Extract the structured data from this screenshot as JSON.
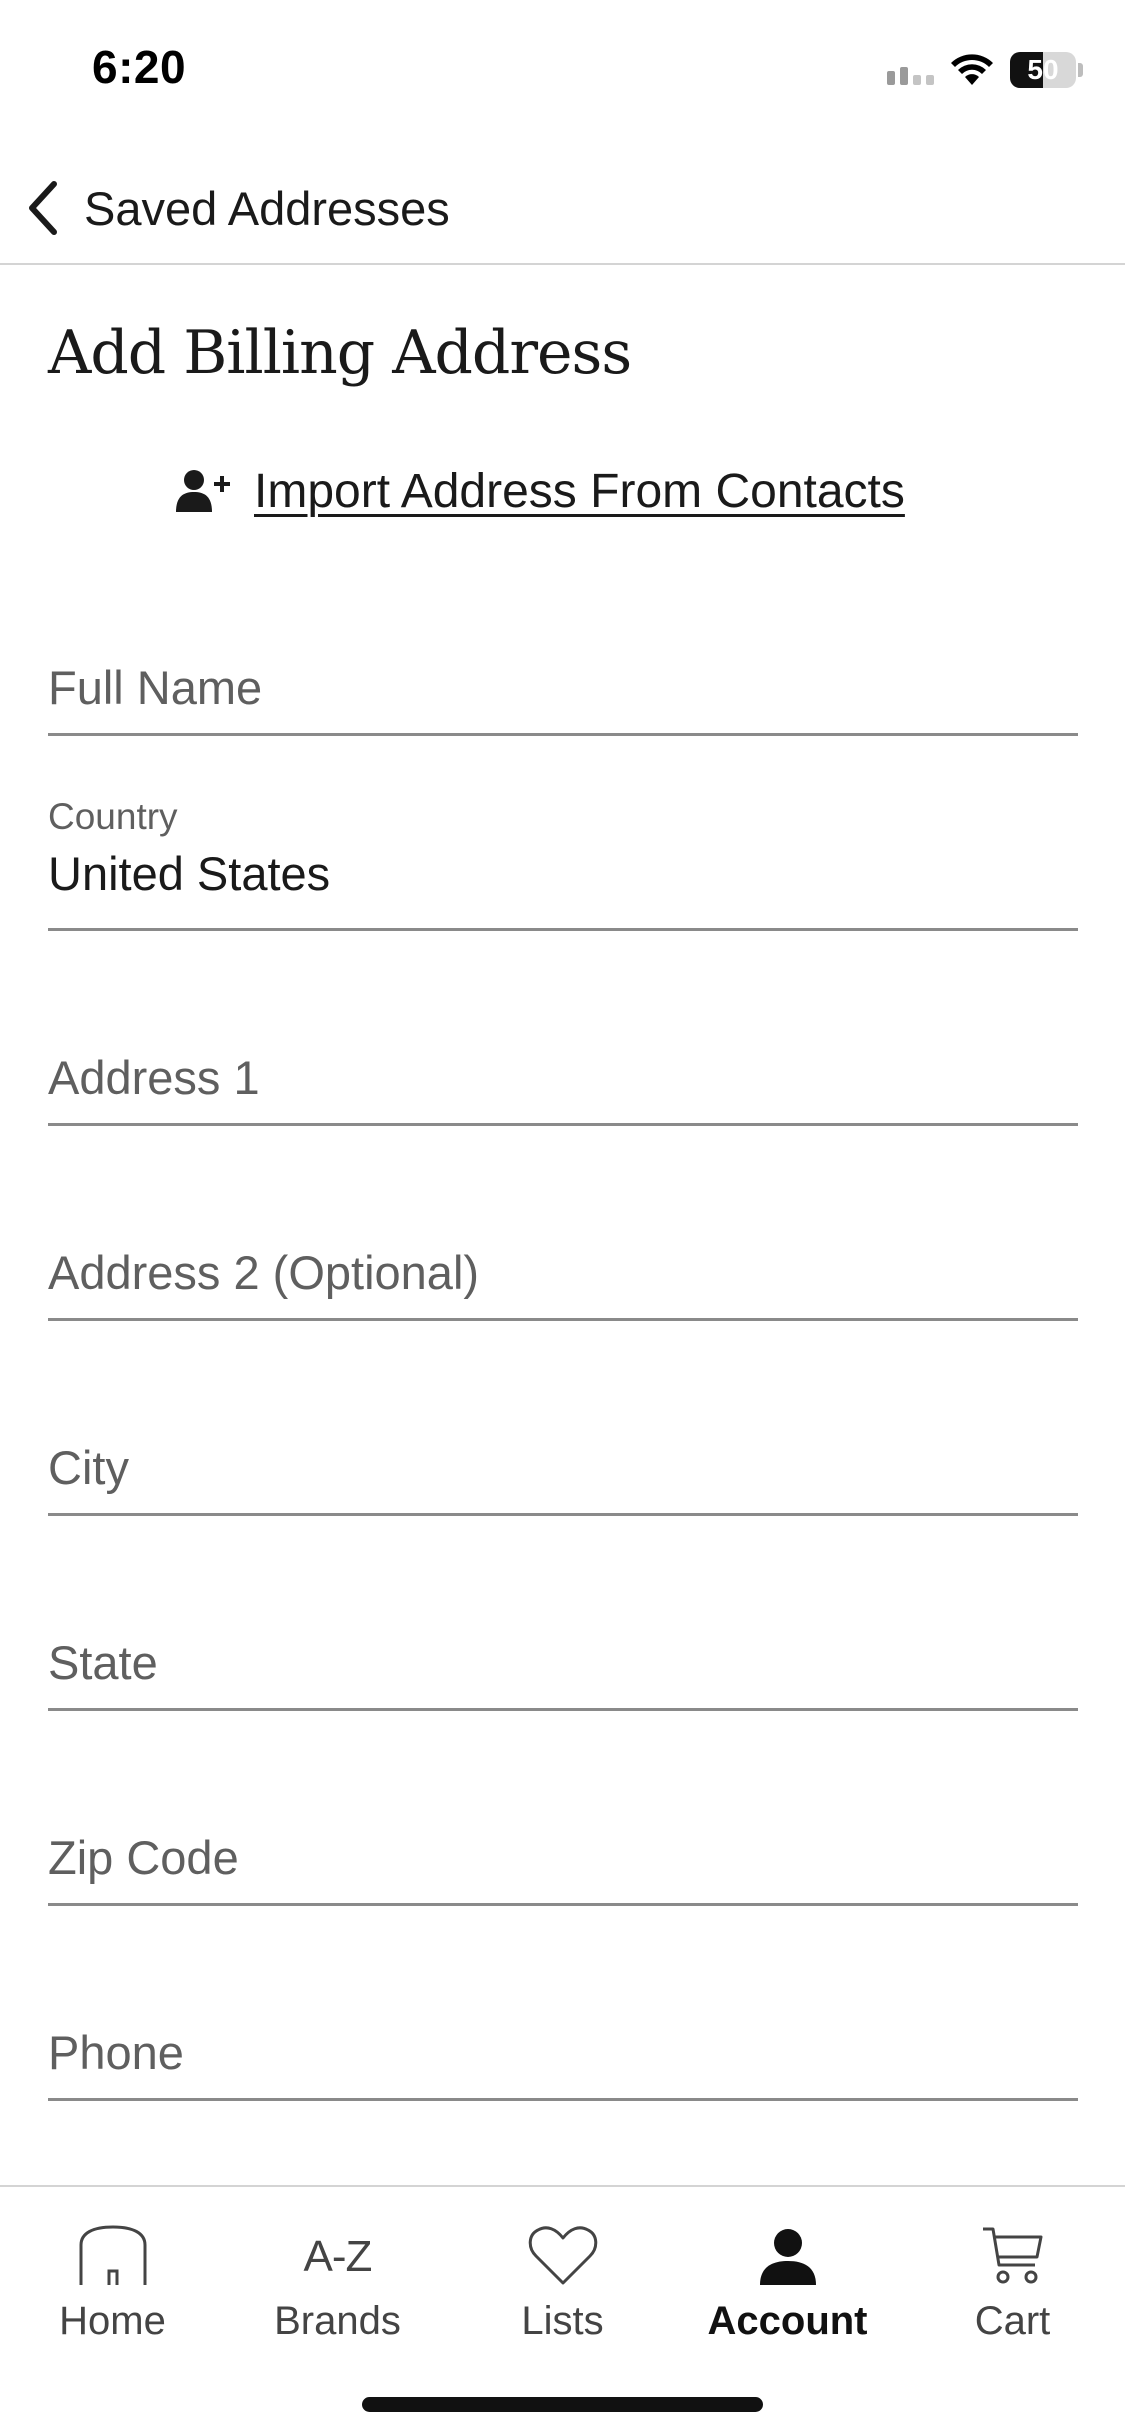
{
  "status_bar": {
    "time": "6:20",
    "battery_percent": "50",
    "battery_level": 0.5
  },
  "header": {
    "back_label": "Saved Addresses"
  },
  "page": {
    "title": "Add Billing Address",
    "import_label": "Import Address From Contacts"
  },
  "form": {
    "full_name": {
      "placeholder": "Full Name",
      "value": ""
    },
    "country": {
      "label": "Country",
      "value": "United States"
    },
    "address1": {
      "placeholder": "Address 1",
      "value": ""
    },
    "address2": {
      "placeholder": "Address 2 (Optional)",
      "value": ""
    },
    "city": {
      "placeholder": "City",
      "value": ""
    },
    "state": {
      "placeholder": "State",
      "value": ""
    },
    "zip": {
      "placeholder": "Zip Code",
      "value": ""
    },
    "phone": {
      "placeholder": "Phone",
      "value": ""
    }
  },
  "tabs": [
    {
      "label": "Home",
      "icon": "home-icon",
      "active": false
    },
    {
      "label": "Brands",
      "icon": "a-z-icon",
      "icon_text": "A-Z",
      "active": false
    },
    {
      "label": "Lists",
      "icon": "heart-icon",
      "active": false
    },
    {
      "label": "Account",
      "icon": "person-icon",
      "active": true
    },
    {
      "label": "Cart",
      "icon": "cart-icon",
      "active": false
    }
  ],
  "colors": {
    "text": "#1a1a1a",
    "placeholder": "#5f5f5f",
    "divider": "#d4d4d4",
    "field_underline": "#8a8a8a"
  }
}
